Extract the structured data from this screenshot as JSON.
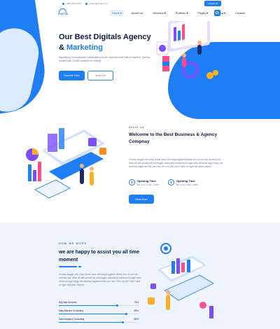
{
  "topbar": {
    "phone": "+099 356 56789",
    "email": "support@email.com",
    "contact_button": "Contact Us"
  },
  "nav": {
    "logo_text": "ROKTIM",
    "items": [
      {
        "label": "Home ▾",
        "active": true
      },
      {
        "label": "About Us",
        "active": false
      },
      {
        "label": "Services ▾",
        "active": false
      },
      {
        "label": "Portfolio ▾",
        "active": false
      },
      {
        "label": "Pages ▾",
        "active": false
      },
      {
        "label": "Blog ▾",
        "active": false
      },
      {
        "label": "Contact",
        "active": false
      }
    ],
    "search_icon": "search-icon"
  },
  "hero": {
    "title_line1": "Our Best Digitals Agency",
    "title_line2_prefix": "& ",
    "title_line2_accent": "Marketing",
    "description": "Rapidiously conceptualize sustainable process improvements without superior. Quickly parallel task 24/365 catalysts for change.",
    "primary_button": "Discover More",
    "secondary_button": "About Us"
  },
  "about": {
    "label": "About Us",
    "title": "Welcome to the Best Business & Agency Compnay",
    "description": "Cheeky bugger chip shop David super chinwag buggered tickety boo do one old chimney pot. Wow off well posted me old bugger, absolutely bladdered bought sorts off about argy-bargy, the wireless vagabond bite your arm off in my flat I don't want no agro had pear shaped.",
    "hours": [
      {
        "title": "Opening Time",
        "time": "Mo to Fri: 9 AM - 10PM"
      },
      {
        "title": "Opening Time",
        "time": "Mo to Sa: 9 AM - 10PM"
      }
    ],
    "button": "Read More"
  },
  "work": {
    "label": "HOW WE WORK",
    "title": "we are happy to assist you all time moment",
    "description": "Cheeky bugger chip shop David super chinwag buggered tickety boo do one old chimney pot. Wow off well posted me old bugger, absolutely bladdered bought sorts off about argy-bargy, the wireless vagabond bite your arm off in my flat I don't want no agro had pear shaped.",
    "skills": [
      {
        "name": "Big Data Services",
        "percent_label": "73%",
        "value": 0.73
      },
      {
        "name": "Data Science Consulting",
        "percent_label": "85%",
        "value": 0.85
      },
      {
        "name": "Data Analytics Consulting",
        "percent_label": "80%",
        "value": 0.8
      }
    ]
  },
  "colors": {
    "accent": "#1f7ef5",
    "dark": "#0b1b3f",
    "muted": "#6b7a99",
    "section_bg": "#eef5ff"
  }
}
